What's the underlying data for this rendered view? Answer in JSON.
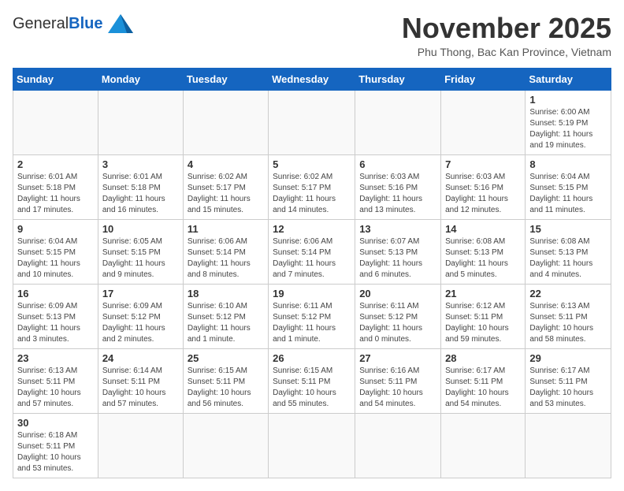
{
  "header": {
    "logo_general": "General",
    "logo_blue": "Blue",
    "month_title": "November 2025",
    "location": "Phu Thong, Bac Kan Province, Vietnam"
  },
  "weekdays": [
    "Sunday",
    "Monday",
    "Tuesday",
    "Wednesday",
    "Thursday",
    "Friday",
    "Saturday"
  ],
  "days": [
    {
      "number": "",
      "info": ""
    },
    {
      "number": "",
      "info": ""
    },
    {
      "number": "",
      "info": ""
    },
    {
      "number": "",
      "info": ""
    },
    {
      "number": "",
      "info": ""
    },
    {
      "number": "",
      "info": ""
    },
    {
      "number": "1",
      "info": "Sunrise: 6:00 AM\nSunset: 5:19 PM\nDaylight: 11 hours\nand 19 minutes."
    },
    {
      "number": "2",
      "info": "Sunrise: 6:01 AM\nSunset: 5:18 PM\nDaylight: 11 hours\nand 17 minutes."
    },
    {
      "number": "3",
      "info": "Sunrise: 6:01 AM\nSunset: 5:18 PM\nDaylight: 11 hours\nand 16 minutes."
    },
    {
      "number": "4",
      "info": "Sunrise: 6:02 AM\nSunset: 5:17 PM\nDaylight: 11 hours\nand 15 minutes."
    },
    {
      "number": "5",
      "info": "Sunrise: 6:02 AM\nSunset: 5:17 PM\nDaylight: 11 hours\nand 14 minutes."
    },
    {
      "number": "6",
      "info": "Sunrise: 6:03 AM\nSunset: 5:16 PM\nDaylight: 11 hours\nand 13 minutes."
    },
    {
      "number": "7",
      "info": "Sunrise: 6:03 AM\nSunset: 5:16 PM\nDaylight: 11 hours\nand 12 minutes."
    },
    {
      "number": "8",
      "info": "Sunrise: 6:04 AM\nSunset: 5:15 PM\nDaylight: 11 hours\nand 11 minutes."
    },
    {
      "number": "9",
      "info": "Sunrise: 6:04 AM\nSunset: 5:15 PM\nDaylight: 11 hours\nand 10 minutes."
    },
    {
      "number": "10",
      "info": "Sunrise: 6:05 AM\nSunset: 5:15 PM\nDaylight: 11 hours\nand 9 minutes."
    },
    {
      "number": "11",
      "info": "Sunrise: 6:06 AM\nSunset: 5:14 PM\nDaylight: 11 hours\nand 8 minutes."
    },
    {
      "number": "12",
      "info": "Sunrise: 6:06 AM\nSunset: 5:14 PM\nDaylight: 11 hours\nand 7 minutes."
    },
    {
      "number": "13",
      "info": "Sunrise: 6:07 AM\nSunset: 5:13 PM\nDaylight: 11 hours\nand 6 minutes."
    },
    {
      "number": "14",
      "info": "Sunrise: 6:08 AM\nSunset: 5:13 PM\nDaylight: 11 hours\nand 5 minutes."
    },
    {
      "number": "15",
      "info": "Sunrise: 6:08 AM\nSunset: 5:13 PM\nDaylight: 11 hours\nand 4 minutes."
    },
    {
      "number": "16",
      "info": "Sunrise: 6:09 AM\nSunset: 5:13 PM\nDaylight: 11 hours\nand 3 minutes."
    },
    {
      "number": "17",
      "info": "Sunrise: 6:09 AM\nSunset: 5:12 PM\nDaylight: 11 hours\nand 2 minutes."
    },
    {
      "number": "18",
      "info": "Sunrise: 6:10 AM\nSunset: 5:12 PM\nDaylight: 11 hours\nand 1 minute."
    },
    {
      "number": "19",
      "info": "Sunrise: 6:11 AM\nSunset: 5:12 PM\nDaylight: 11 hours\nand 1 minute."
    },
    {
      "number": "20",
      "info": "Sunrise: 6:11 AM\nSunset: 5:12 PM\nDaylight: 11 hours\nand 0 minutes."
    },
    {
      "number": "21",
      "info": "Sunrise: 6:12 AM\nSunset: 5:11 PM\nDaylight: 10 hours\nand 59 minutes."
    },
    {
      "number": "22",
      "info": "Sunrise: 6:13 AM\nSunset: 5:11 PM\nDaylight: 10 hours\nand 58 minutes."
    },
    {
      "number": "23",
      "info": "Sunrise: 6:13 AM\nSunset: 5:11 PM\nDaylight: 10 hours\nand 57 minutes."
    },
    {
      "number": "24",
      "info": "Sunrise: 6:14 AM\nSunset: 5:11 PM\nDaylight: 10 hours\nand 57 minutes."
    },
    {
      "number": "25",
      "info": "Sunrise: 6:15 AM\nSunset: 5:11 PM\nDaylight: 10 hours\nand 56 minutes."
    },
    {
      "number": "26",
      "info": "Sunrise: 6:15 AM\nSunset: 5:11 PM\nDaylight: 10 hours\nand 55 minutes."
    },
    {
      "number": "27",
      "info": "Sunrise: 6:16 AM\nSunset: 5:11 PM\nDaylight: 10 hours\nand 54 minutes."
    },
    {
      "number": "28",
      "info": "Sunrise: 6:17 AM\nSunset: 5:11 PM\nDaylight: 10 hours\nand 54 minutes."
    },
    {
      "number": "29",
      "info": "Sunrise: 6:17 AM\nSunset: 5:11 PM\nDaylight: 10 hours\nand 53 minutes."
    },
    {
      "number": "30",
      "info": "Sunrise: 6:18 AM\nSunset: 5:11 PM\nDaylight: 10 hours\nand 53 minutes."
    },
    {
      "number": "",
      "info": ""
    },
    {
      "number": "",
      "info": ""
    },
    {
      "number": "",
      "info": ""
    },
    {
      "number": "",
      "info": ""
    },
    {
      "number": "",
      "info": ""
    },
    {
      "number": "",
      "info": ""
    }
  ]
}
